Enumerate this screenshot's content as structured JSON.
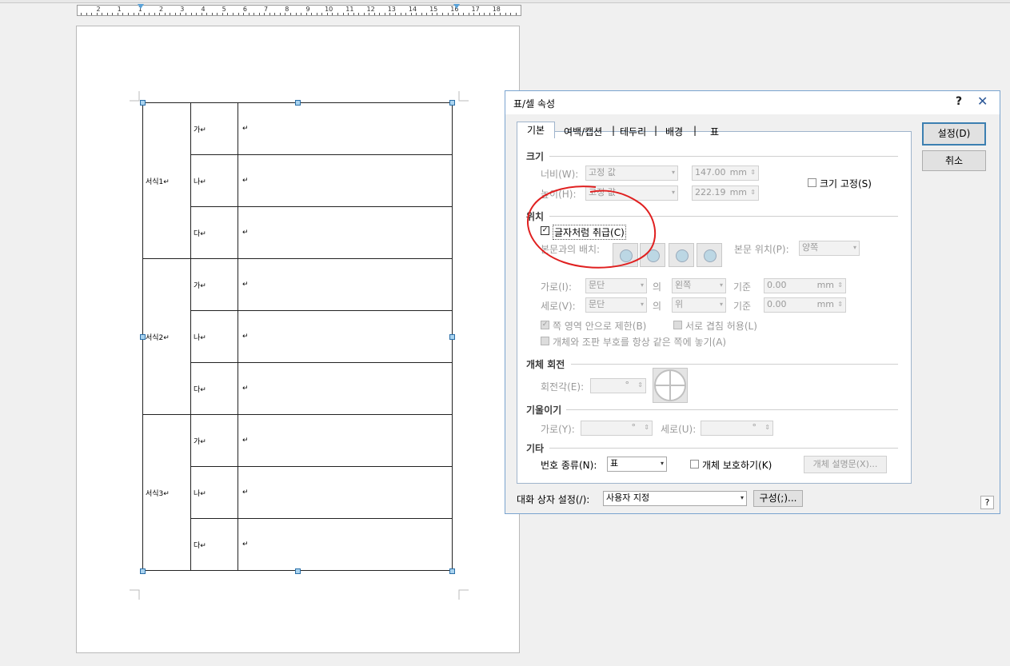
{
  "ruler": {
    "labels": [
      "2",
      "1",
      "1",
      "2",
      "3",
      "4",
      "5",
      "6",
      "7",
      "8",
      "9",
      "10",
      "11",
      "12",
      "13",
      "14",
      "15",
      "16",
      "17",
      "18"
    ]
  },
  "document": {
    "groups": [
      {
        "label": "서식1↵",
        "rows": [
          {
            "sub": "가↵",
            "content": "↵"
          },
          {
            "sub": "나↵",
            "content": "↵"
          },
          {
            "sub": "다↵",
            "content": "↵"
          }
        ]
      },
      {
        "label": "서식2↵",
        "rows": [
          {
            "sub": "가↵",
            "content": "↵"
          },
          {
            "sub": "나↵",
            "content": "↵"
          },
          {
            "sub": "다↵",
            "content": "↵"
          }
        ]
      },
      {
        "label": "서식3↵",
        "rows": [
          {
            "sub": "가↵",
            "content": "↵"
          },
          {
            "sub": "나↵",
            "content": "↵"
          },
          {
            "sub": "다↵",
            "content": "↵"
          }
        ]
      }
    ]
  },
  "dialog": {
    "title": "표/셀 속성",
    "help_label": "?",
    "close_label": "✕",
    "tabs": [
      "기본",
      "여백/캡션",
      "테두리",
      "배경",
      "표"
    ],
    "tab_separator": "|",
    "ok_label": "설정(D)",
    "cancel_label": "취소",
    "size": {
      "heading": "크기",
      "width_label": "너비(W):",
      "width_mode": "고정 값",
      "width_value": "147.00",
      "height_label": "높이(H):",
      "height_mode": "고정 값",
      "height_value": "222.19",
      "unit": "mm",
      "fixed_size_label": "크기 고정(S)"
    },
    "position": {
      "heading": "위치",
      "treat_as_char_label": "글자처럼 취급(C)",
      "treat_as_char_checked": true,
      "text_wrap_label": "본문과의 배치:",
      "body_position_label": "본문 위치(P):",
      "body_position_value": "양쪽",
      "horizontal_label": "가로(I):",
      "horizontal_ref": "문단",
      "horizontal_of": "의",
      "horizontal_align": "왼쪽",
      "horizontal_base": "기준",
      "horizontal_value": "0.00",
      "vertical_label": "세로(V):",
      "vertical_ref": "문단",
      "vertical_of": "의",
      "vertical_align": "위",
      "vertical_base": "기준",
      "vertical_value": "0.00",
      "unit": "mm",
      "limit_page_label": "쪽 영역 안으로 제한(B)",
      "overlap_label": "서로 겹침 허용(L)",
      "same_page_label": "개체와 조판 부호를 항상 같은 쪽에 놓기(A)"
    },
    "rotation": {
      "heading": "개체 회전",
      "angle_label": "회전각(E):",
      "angle_unit": "°"
    },
    "skew": {
      "heading": "기울이기",
      "h_label": "가로(Y):",
      "v_label": "세로(U):",
      "unit": "°"
    },
    "etc": {
      "heading": "기타",
      "numbering_label": "번호 종류(N):",
      "numbering_value": "표",
      "protect_label": "개체 보호하기(K)",
      "description_button": "개체 설명문(X)..."
    },
    "footer": {
      "dialog_setting_label": "대화 상자 설정(/):",
      "dialog_setting_value": "사용자 지정",
      "compose_button": "구성(;)...",
      "help_icon_label": "?"
    },
    "annotation_color": "#e02020"
  }
}
